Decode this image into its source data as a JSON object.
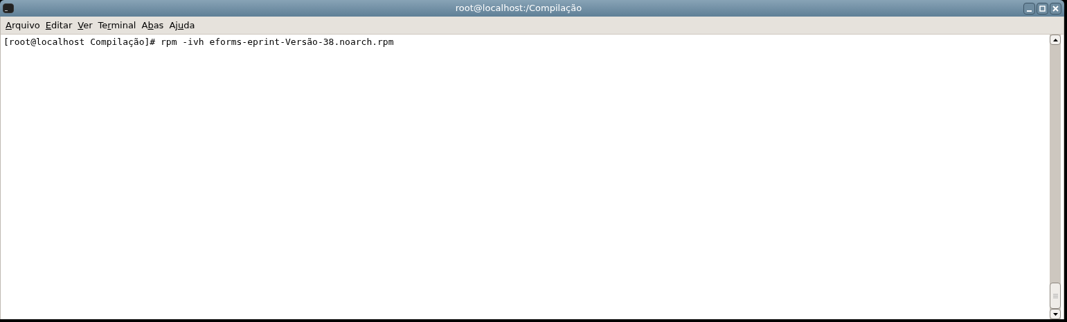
{
  "window": {
    "title": "root@localhost:/Compilação"
  },
  "menu": [
    {
      "parts": [
        {
          "text": "A",
          "underlined": true
        },
        {
          "text": "rquivo",
          "underlined": false
        }
      ]
    },
    {
      "parts": [
        {
          "text": "E",
          "underlined": true
        },
        {
          "text": "ditar",
          "underlined": false
        }
      ]
    },
    {
      "parts": [
        {
          "text": "V",
          "underlined": true
        },
        {
          "text": "er",
          "underlined": false
        }
      ]
    },
    {
      "parts": [
        {
          "text": "Te",
          "underlined": false
        },
        {
          "text": "r",
          "underlined": true
        },
        {
          "text": "minal",
          "underlined": false
        }
      ]
    },
    {
      "parts": [
        {
          "text": "A",
          "underlined": false
        },
        {
          "text": "b",
          "underlined": true
        },
        {
          "text": "as",
          "underlined": false
        }
      ]
    },
    {
      "parts": [
        {
          "text": "Aj",
          "underlined": false
        },
        {
          "text": "u",
          "underlined": true
        },
        {
          "text": "da",
          "underlined": false
        }
      ]
    }
  ],
  "terminal": {
    "lines": [
      "[root@localhost Compilação]# rpm -ivh eforms-eprint-Versão-38.noarch.rpm"
    ]
  }
}
